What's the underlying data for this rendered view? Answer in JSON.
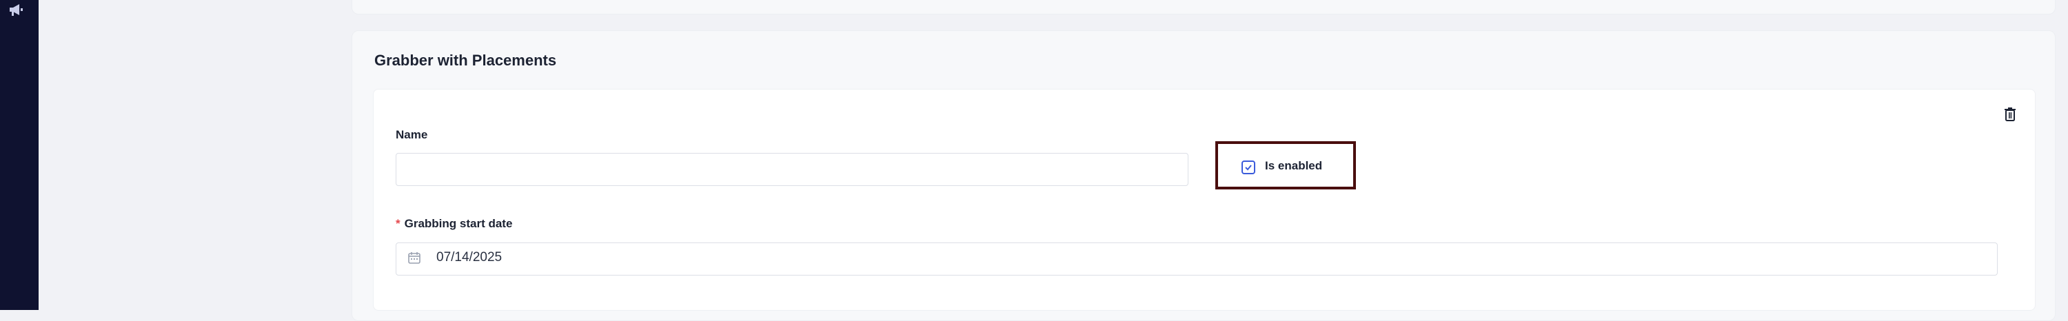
{
  "sidebar": {
    "logo_icon": "megaphone-icon"
  },
  "section": {
    "title": "Grabber with Placements",
    "delete_icon": "trash-icon",
    "name_field": {
      "label": "Name",
      "value": "",
      "placeholder": ""
    },
    "enabled_checkbox": {
      "label": "Is enabled",
      "checked": true
    },
    "start_date_field": {
      "required_marker": "*",
      "label": "Grabbing start date",
      "value": "07/14/2025",
      "icon": "calendar-icon"
    }
  },
  "colors": {
    "sidebar": "#0f1230",
    "accent": "#3b5bdb",
    "highlight_border": "#4a0e0e",
    "required": "#e5484d"
  }
}
